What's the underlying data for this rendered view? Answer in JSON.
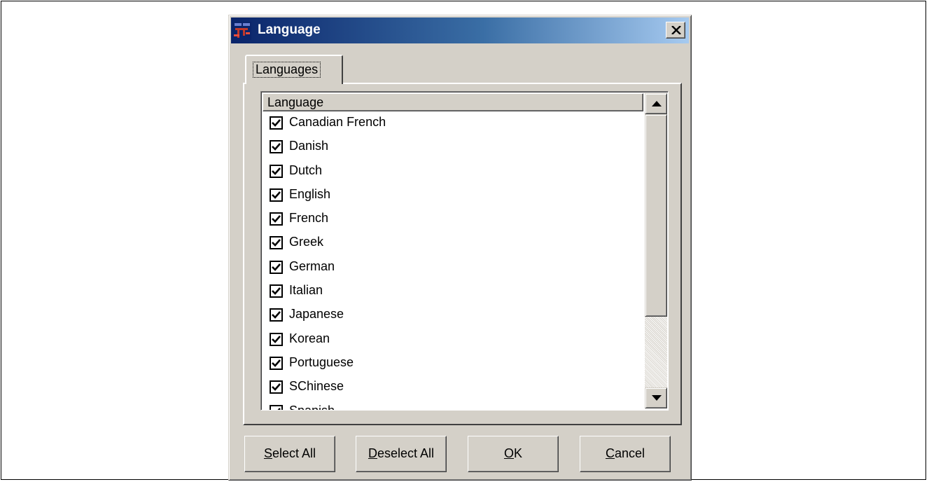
{
  "window": {
    "title": "Language",
    "close_icon": "close-icon",
    "app_icon": "application-icon"
  },
  "tabs": [
    {
      "label": "Languages",
      "selected": true
    }
  ],
  "list": {
    "column_header": "Language",
    "items": [
      {
        "label": "Canadian French",
        "checked": true
      },
      {
        "label": "Danish",
        "checked": true
      },
      {
        "label": "Dutch",
        "checked": true
      },
      {
        "label": "English",
        "checked": true
      },
      {
        "label": "French",
        "checked": true
      },
      {
        "label": "Greek",
        "checked": true
      },
      {
        "label": "German",
        "checked": true
      },
      {
        "label": "Italian",
        "checked": true
      },
      {
        "label": "Japanese",
        "checked": true
      },
      {
        "label": "Korean",
        "checked": true
      },
      {
        "label": "Portuguese",
        "checked": true
      },
      {
        "label": "SChinese",
        "checked": true
      },
      {
        "label": "Spanish",
        "checked": true
      }
    ]
  },
  "buttons": {
    "select_all": {
      "accel": "S",
      "rest": "elect All"
    },
    "deselect_all": {
      "accel": "D",
      "rest": "eselect All"
    },
    "ok": {
      "accel": "O",
      "rest": "K"
    },
    "cancel": {
      "accel": "C",
      "rest": "ancel"
    }
  },
  "colors": {
    "title_gradient_start": "#0a246a",
    "title_gradient_end": "#a6caf0",
    "face": "#d4d0c8"
  }
}
